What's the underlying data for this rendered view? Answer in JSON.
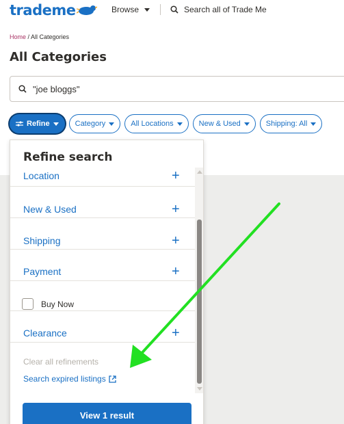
{
  "header": {
    "logo_text": "trademe",
    "browse_label": "Browse",
    "search_label": "Search all of Trade Me"
  },
  "breadcrumb": {
    "home": "Home",
    "separator": " / ",
    "current": "All Categories"
  },
  "page_title": "All Categories",
  "search": {
    "value": "\"joe bloggs\""
  },
  "filters": [
    {
      "label": "Refine",
      "active": true
    },
    {
      "label": "Category",
      "active": false
    },
    {
      "label": "All Locations",
      "active": false
    },
    {
      "label": "New & Used",
      "active": false
    },
    {
      "label": "Shipping: All",
      "active": false
    }
  ],
  "refine_panel": {
    "title": "Refine search",
    "rows": {
      "location": "Location",
      "new_used": "New & Used",
      "shipping": "Shipping",
      "payment": "Payment",
      "buy_now": "Buy Now",
      "clearance": "Clearance"
    },
    "clear_all": "Clear all refinements",
    "search_expired": "Search expired listings",
    "result_button": "View 1 result"
  },
  "colors": {
    "brand_blue": "#1a70c4",
    "annotation_arrow": "#22e022"
  },
  "icons": {
    "search": "search-icon",
    "refine": "sliders-icon",
    "external": "external-link-icon",
    "plus": "plus-icon"
  }
}
